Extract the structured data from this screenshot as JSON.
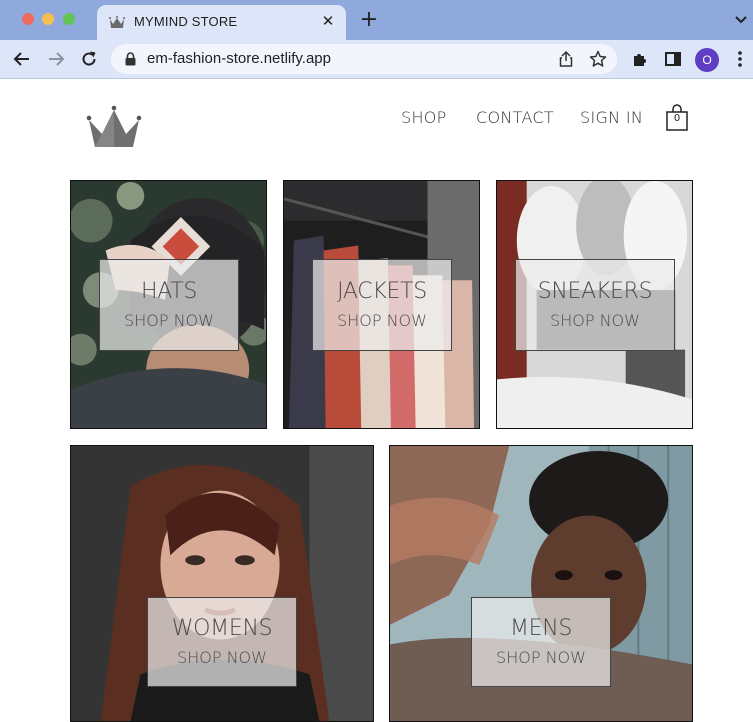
{
  "browser": {
    "tab_title": "MYMIND STORE",
    "url": "em-fashion-store.netlify.app",
    "profile_initial": "O",
    "colors": {
      "tabstrip": "#8fa9dc",
      "toolbar": "#dce6f8",
      "avatar": "#5f3dc4"
    }
  },
  "header": {
    "logo": "crown-logo",
    "nav": {
      "shop": "SHOP",
      "contact": "CONTACT",
      "sign_in": "SIGN IN"
    },
    "cart_count": "0"
  },
  "categories": [
    {
      "title": "HATS",
      "cta": "SHOP NOW"
    },
    {
      "title": "JACKETS",
      "cta": "SHOP NOW"
    },
    {
      "title": "SNEAKERS",
      "cta": "SHOP NOW"
    },
    {
      "title": "WOMENS",
      "cta": "SHOP NOW"
    },
    {
      "title": "MENS",
      "cta": "SHOP NOW"
    }
  ]
}
